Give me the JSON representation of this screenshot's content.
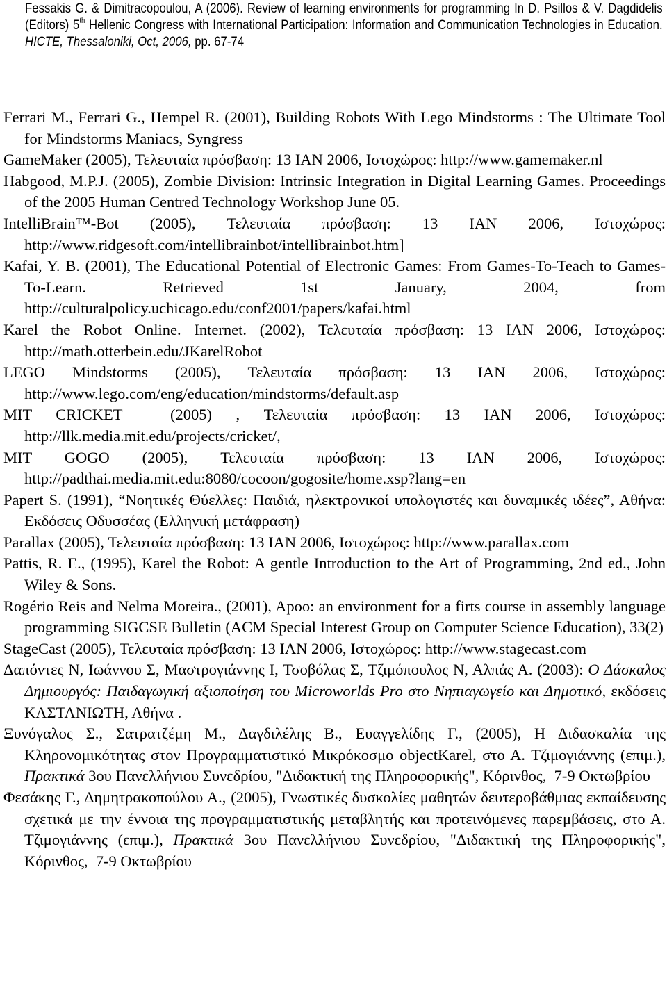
{
  "top_reference": {
    "part1": "Fessakis G. & Dimitracopoulou, A (2006). Review of learning environments for programming In D. Psillos & V. Dagdidelis (Editors) 5",
    "sup": "th",
    "part2": " Hellenic Congress with International Participation: Information and Communication Technologies in Education. ",
    "italic": "HICTE, Thessaloniki, Oct, 2006,",
    "part3": " pp. 67-74"
  },
  "references": [
    {
      "text": "Ferrari M., Ferrari G., Hempel R. (2001), Building Robots With Lego Mindstorms : The Ultimate Tool for Mindstorms Maniacs, Syngress"
    },
    {
      "text": "GameMaker (2005), Τελευταία πρόσβαση: 13 ΙΑΝ 2006, Ιστοχώρος: http://www.gamemaker.nl"
    },
    {
      "text": "Habgood, M.P.J. (2005), Zombie Division: Intrinsic Integration in Digital Learning Games. Proceedings of the 2005 Human Centred Technology Workshop June 05."
    },
    {
      "text": "IntelliBrain™-Bot (2005), Τελευταία πρόσβαση: 13 ΙΑΝ 2006, Ιστοχώρος: http://www.ridgesoft.com/intellibrainbot/intellibrainbot.htm]"
    },
    {
      "text": "Kafai, Y. B. (2001), The Educational Potential of Electronic Games: From Games-To-Teach to Games-To-Learn. Retrieved 1st January, 2004, from http://culturalpolicy.uchicago.edu/conf2001/papers/kafai.html"
    },
    {
      "text": "Karel the Robot Online. Internet. (2002), Τελευταία πρόσβαση: 13 ΙΑΝ 2006, Ιστοχώρος: http://math.otterbein.edu/JKarelRobot"
    },
    {
      "text": "LEGO Mindstorms (2005), Τελευταία πρόσβαση: 13 ΙΑΝ 2006, Ιστοχώρος: http://www.lego.com/eng/education/mindstorms/default.asp"
    },
    {
      "text": "MIT CRICKET  (2005) , Τελευταία πρόσβαση: 13 ΙΑΝ 2006, Ιστοχώρος: http://llk.media.mit.edu/projects/cricket/,"
    },
    {
      "text": "MIT GOGO (2005), Τελευταία πρόσβαση: 13 ΙΑΝ 2006, Ιστοχώρος: http://padthai.media.mit.edu:8080/cocoon/gogosite/home.xsp?lang=en"
    },
    {
      "text": "Papert S. (1991), “Νοητικές Θύελλες: Παιδιά, ηλεκτρονικοί υπολογιστές και δυναμικές ιδέες”, Αθήνα: Εκδόσεις Οδυσσέας (Ελληνική μετάφραση)"
    },
    {
      "text": "Parallax (2005), Τελευταία πρόσβαση: 13 ΙΑΝ 2006, Ιστοχώρος: http://www.parallax.com"
    },
    {
      "text": "Pattis, R. E., (1995), Karel the Robot: A gentle Introduction to the Art of Programming, 2nd ed., John Wiley & Sons."
    },
    {
      "text": "Rogério Reis and Nelma Moreira., (2001), Apoo: an environment for a firts course in assembly language programming SIGCSE Bulletin (ACM Special Interest Group on Computer Science Education), 33(2)"
    },
    {
      "text": "StageCast (2005), Τελευταία πρόσβαση: 13 ΙΑΝ 2006, Ιστοχώρος: http://www.stagecast.com"
    },
    {
      "pre": "Δαπόντες Ν, Ιωάννου Σ, Μαστρογιάννης Ι, Τσοβόλας Σ, Τζιμόπουλος Ν, Αλπάς Α. (2003): ",
      "italic": "Ο Δάσκαλος Δημιουργός: Παιδαγωγική αξιοποίηση του Microworlds Pro στο Νηπιαγωγείο και Δημοτικό",
      "post": ", εκδόσεις ΚΑΣΤΑΝΙΩΤΗ, Αθήνα ."
    },
    {
      "pre": "Ξυνόγαλος Σ., Σατρατζέμη Μ., Δαγδιλέλης Β., Ευαγγελίδης Γ., (2005), Η Διδασκαλία της Κληρονομικότητας στον Προγραμματιστικό Μικρόκοσμο objectKarel, στο Α. Τζιμογιάννης (επιμ.), ",
      "italic": "Πρακτικά",
      "post": " 3ου Πανελλήνιου Συνεδρίου, \"Διδακτική της Πληροφορικής\", Κόρινθος,  7-9 Οκτωβρίου"
    },
    {
      "pre": "Φεσάκης Γ., Δημητρακοπούλου Α., (2005), Γνωστικές δυσκολίες μαθητών δευτεροβάθμιας εκπαίδευσης σχετικά με την έννοια της προγραμματιστικής μεταβλητής και προτεινόμενες παρεμβάσεις, στο Α. Τζιμογιάννης (επιμ.), ",
      "italic": "Πρακτικά",
      "post": " 3ου Πανελλήνιου Συνεδρίου, \"Διδακτική της Πληροφορικής\", Κόρινθος,  7-9 Οκτωβρίου"
    }
  ]
}
